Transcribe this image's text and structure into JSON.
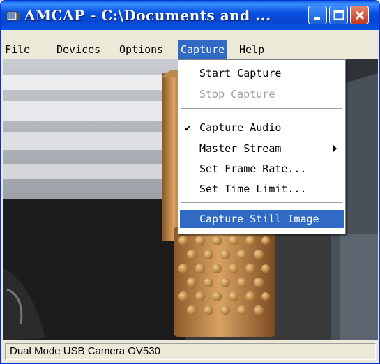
{
  "window": {
    "title": "AMCAP - C:\\Documents and ..."
  },
  "menubar": {
    "items": [
      {
        "label": "File",
        "key": "F",
        "rest": "ile"
      },
      {
        "label": "Devices",
        "key": "D",
        "rest": "evices"
      },
      {
        "label": "Options",
        "key": "O",
        "rest": "ptions"
      },
      {
        "label": "Capture",
        "key": "C",
        "rest": "apture"
      },
      {
        "label": "Help",
        "key": "H",
        "rest": "elp"
      }
    ]
  },
  "capture_menu": {
    "items": [
      {
        "label": "Start Capture",
        "enabled": true
      },
      {
        "label": "Stop Capture",
        "enabled": false
      },
      {
        "label": "Capture Audio",
        "checked": true,
        "check_glyph": "✔"
      },
      {
        "label": "Master Stream",
        "submenu": true
      },
      {
        "label": "Set Frame Rate...",
        "enabled": true
      },
      {
        "label": "Set Time Limit...",
        "enabled": true
      },
      {
        "label": "Capture Still Image",
        "highlighted": true
      }
    ]
  },
  "statusbar": {
    "text": "Dual Mode USB Camera OV530"
  },
  "colors": {
    "titlebar": "#0a52e0",
    "highlight": "#316ac5",
    "close_button": "#c2391c"
  }
}
